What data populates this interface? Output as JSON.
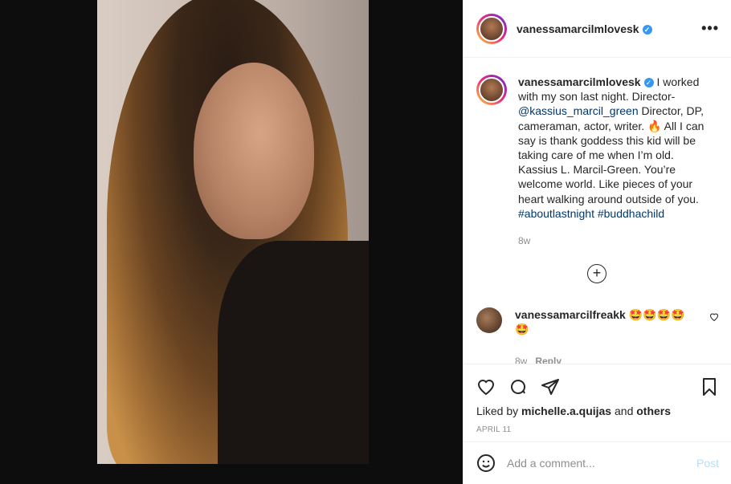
{
  "post": {
    "username": "vanessamarcilmlovesk",
    "verified_mark": "✓",
    "more_label": "•••"
  },
  "caption": {
    "username": "vanessamarcilmlovesk",
    "text_1": " I worked with my son last night. Director-",
    "mention": "@kassius_marcil_green",
    "text_2": " Director, DP, cameraman, actor, writer. 🔥 All I can say is thank goddess this kid will be taking care of me when I’m old. Kassius L. Marcil-Green. You’re welcome world. Like pieces of your heart walking around outside of you. ",
    "hashtag_1": "#aboutlastnight",
    "hashtag_2": "#buddhachild",
    "time": "8w"
  },
  "load_more_label": "+",
  "comment": {
    "username": "vanessamarcilfreakk",
    "text": " 🤩🤩🤩🤩🤩",
    "time": "8w",
    "reply_label": "Reply"
  },
  "likes": {
    "prefix": "Liked by ",
    "user": "michelle.a.quijas",
    "and": " and ",
    "others": "others"
  },
  "date": "APRIL 11",
  "add_comment": {
    "emoji_icon": "smiley-icon",
    "placeholder": "Add a comment...",
    "post_label": "Post"
  },
  "colors": {
    "link": "#00376b",
    "verified": "#3897f0",
    "post_disabled": "#b2dffc"
  }
}
